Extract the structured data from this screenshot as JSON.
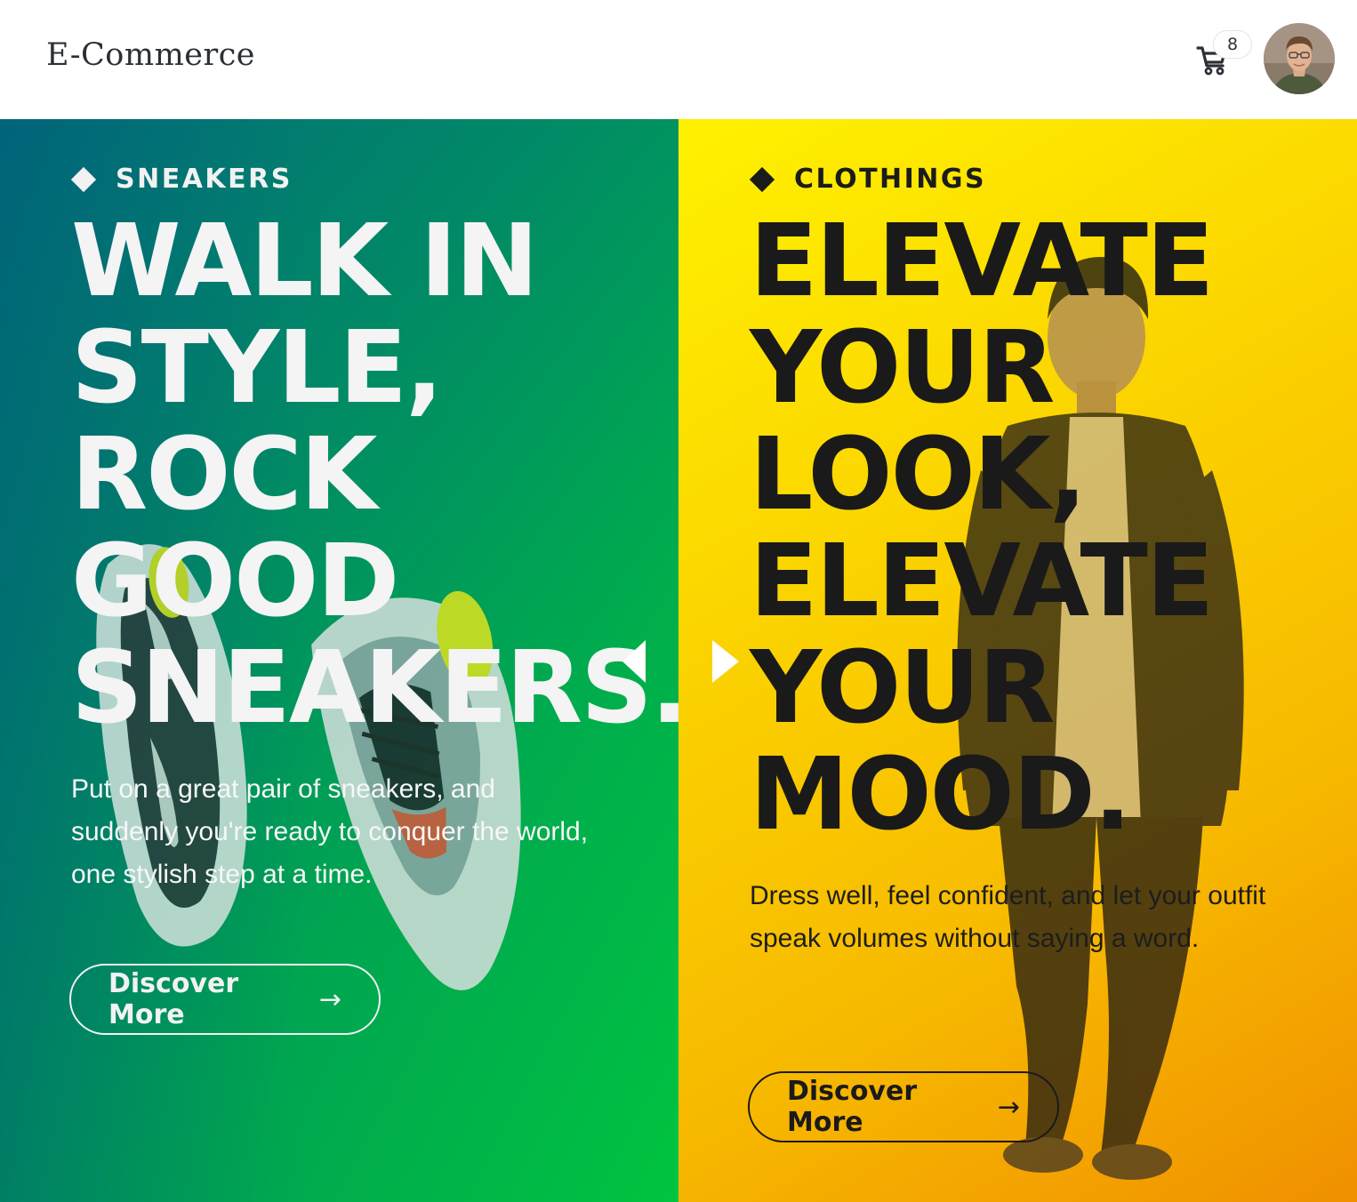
{
  "header": {
    "brand": "E-Commerce",
    "cart_count": "8",
    "cart_icon": "cart-icon",
    "avatar_icon": "user-avatar"
  },
  "panels": [
    {
      "tag": "SNEAKERS",
      "headline": "WALK IN STYLE, ROCK GOOD SNEAKERS.",
      "description": "Put on a great pair of sneakers, and suddenly you're ready to conquer the world, one stylish step at a time.",
      "button_label": "Discover More",
      "button_icon": "arrow-right-icon",
      "accent": "#00ae4c"
    },
    {
      "tag": "CLOTHINGS",
      "headline": "ELEVATE YOUR LOOK, ELEVATE YOUR MOOD.",
      "description": "Dress well, feel confident, and let your outfit speak volumes without saying a word.",
      "button_label": "Discover More",
      "button_icon": "arrow-right-icon",
      "accent": "#fbd500"
    }
  ],
  "slider": {
    "prev_icon": "triangle-left-icon",
    "next_icon": "triangle-right-icon"
  }
}
